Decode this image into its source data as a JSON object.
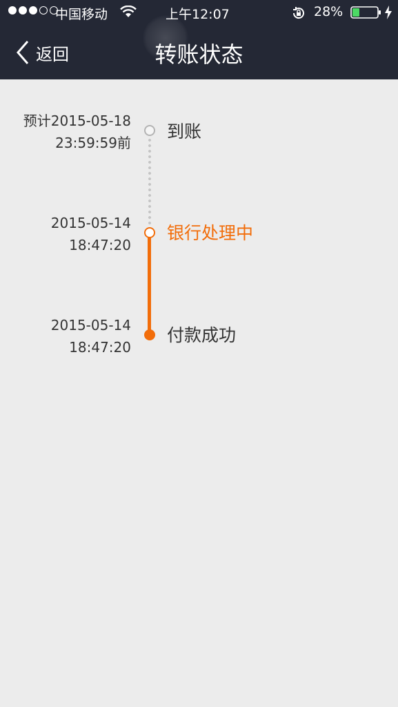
{
  "status_bar": {
    "carrier": "中国移动",
    "time": "上午12:07",
    "battery_percent": "28%",
    "battery_level": 0.28,
    "signal_bars_filled": 3,
    "signal_bars_total": 5,
    "icons": [
      "wifi-icon",
      "rotation-lock-icon",
      "battery-icon",
      "charging-icon"
    ]
  },
  "nav": {
    "back_label": "返回",
    "title": "转账状态"
  },
  "timeline": {
    "steps": [
      {
        "time_line1": "预计2015-05-18",
        "time_line2": "23:59:59前",
        "label": "到账",
        "state": "pending"
      },
      {
        "time_line1": "2015-05-14",
        "time_line2": "18:47:20",
        "label": "银行处理中",
        "state": "active"
      },
      {
        "time_line1": "2015-05-14",
        "time_line2": "18:47:20",
        "label": "付款成功",
        "state": "done"
      }
    ]
  },
  "colors": {
    "header_bg": "#242835",
    "page_bg": "#ececec",
    "accent": "#f26d0a",
    "pending": "#b3b3b3",
    "text": "#333333",
    "battery_fill": "#4cd964"
  }
}
